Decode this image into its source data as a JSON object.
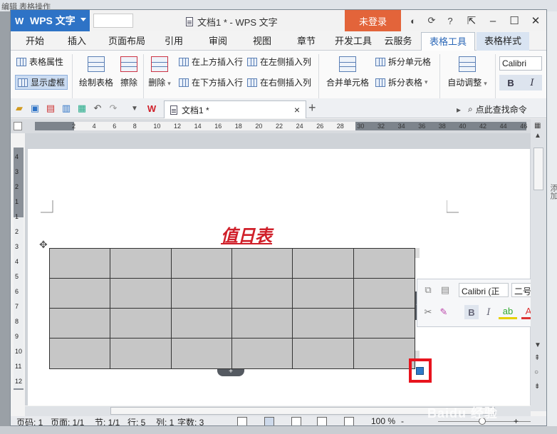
{
  "background": {
    "top_text": "编辑 表格操作",
    "right_text": "添加"
  },
  "titlebar": {
    "app_name": "WPS 文字",
    "doc_title": "文档1 * - WPS 文字",
    "login": "未登录",
    "help": "?"
  },
  "tabs": [
    "开始",
    "插入",
    "页面布局",
    "引用",
    "审阅",
    "视图",
    "章节",
    "开发工具",
    "云服务",
    "表格工具",
    "表格样式"
  ],
  "ribbon": {
    "table_props": "表格属性",
    "show_gridlines": "显示虚框",
    "draw_table": "绘制表格",
    "eraser": "擦除",
    "delete": "删除",
    "insert_above": "在上方插入行",
    "insert_below": "在下方插入行",
    "insert_left": "在左侧插入列",
    "insert_right": "在右侧插入列",
    "merge_cells": "合并单元格",
    "split_cells": "拆分单元格",
    "split_table": "拆分表格",
    "auto_fit": "自动调整",
    "font": "Calibri (正",
    "bold": "B",
    "italic": "I"
  },
  "docbar": {
    "doc_tab": "文档1 *",
    "close": "×",
    "new_tab": "+",
    "find": "点此查找命令"
  },
  "ruler": {
    "numbers": [
      "2",
      "4",
      "6",
      "8",
      "10",
      "12",
      "14",
      "16",
      "18",
      "20",
      "22",
      "24",
      "26",
      "28",
      "30",
      "32",
      "34",
      "36",
      "38",
      "40",
      "42",
      "44",
      "46"
    ]
  },
  "vruler": {
    "numbers": [
      "4",
      "3",
      "2",
      "1",
      "1",
      "2",
      "3",
      "4",
      "5",
      "6",
      "7",
      "8",
      "9",
      "10",
      "11",
      "12"
    ]
  },
  "document": {
    "title": "值日表",
    "table": {
      "rows": 4,
      "cols": 6
    }
  },
  "mini_toolbar": {
    "font": "Calibri (正",
    "size": "二号",
    "bold": "B",
    "italic": "I",
    "font_color_letter": "A"
  },
  "status": {
    "page_code": "页码: 1",
    "page": "页面: 1/1",
    "section": "节: 1/1",
    "row": "行: 5",
    "col": "列: 1",
    "words": "字数: 3",
    "zoom": "100 %",
    "minus": "-",
    "plus": "+"
  },
  "watermark": "Baidu 经验",
  "colors": {
    "wps_blue": "#2e73c6",
    "login_orange": "#e3643a",
    "title_red": "#d0202a",
    "highlight_red": "#e8141e"
  }
}
